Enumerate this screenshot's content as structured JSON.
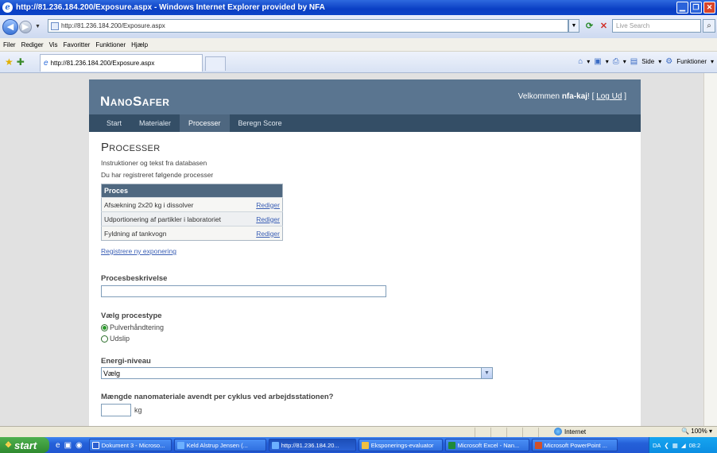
{
  "window": {
    "title": "http://81.236.184.200/Exposure.aspx - Windows Internet Explorer provided by NFA"
  },
  "address": {
    "url": "http://81.236.184.200/Exposure.aspx",
    "search_placeholder": "Live Search"
  },
  "menu": [
    "Filer",
    "Rediger",
    "Vis",
    "Favoritter",
    "Funktioner",
    "Hjælp"
  ],
  "tab": {
    "label": "http://81.236.184.200/Exposure.aspx"
  },
  "commandbar": {
    "page": "Side",
    "tools": "Funktioner"
  },
  "site": {
    "logo": "NanoSafer",
    "welcome_prefix": "Velkommen",
    "user": "nfa-kaj",
    "logout_open": "! [",
    "logout": "Log Ud",
    "logout_close": "]",
    "nav": [
      "Start",
      "Materialer",
      "Processer",
      "Beregn Score"
    ]
  },
  "main": {
    "heading": "Processer",
    "instructions": "Instruktioner og tekst fra databasen",
    "registered": "Du har registreret følgende processer",
    "table": {
      "header": "Proces",
      "rows": [
        {
          "name": "Afsækning 2x20 kg i dissolver",
          "action": "Rediger"
        },
        {
          "name": "Udportionering af partikler i laboratoriet",
          "action": "Rediger"
        },
        {
          "name": "Fyldning af tankvogn",
          "action": "Rediger"
        }
      ]
    },
    "new_link": "Registrere ny exponering",
    "desc_label": "Procesbeskrivelse",
    "type_label": "Vælg procestype",
    "type_options": [
      "Pulverhåndtering",
      "Udslip"
    ],
    "type_selected": "Pulverhåndtering",
    "energy_label": "Energi-niveau",
    "energy_value": "Vælg",
    "amount_label": "Mængde nanomateriale avendt per cyklus ved arbejdsstationen?",
    "amount_unit": "kg"
  },
  "status": {
    "zone": "Internet",
    "zoom": "100%"
  },
  "taskbar": {
    "start": "start",
    "tasks": [
      {
        "label": "Dokument 3 - Microso...",
        "color": "#2b5fd0"
      },
      {
        "label": "Keld Alstrup Jensen (...",
        "color": "#2b6bd8"
      },
      {
        "label": "http://81.236.184.20...",
        "color": "#2b6bd8"
      },
      {
        "label": "Eksponerings-evaluator",
        "color": "#f0c040"
      },
      {
        "label": "Microsoft Excel - Nan...",
        "color": "#1f8a3a"
      },
      {
        "label": "Microsoft PowerPoint ...",
        "color": "#d0502a"
      }
    ],
    "lang": "DA",
    "time": "08:2"
  }
}
